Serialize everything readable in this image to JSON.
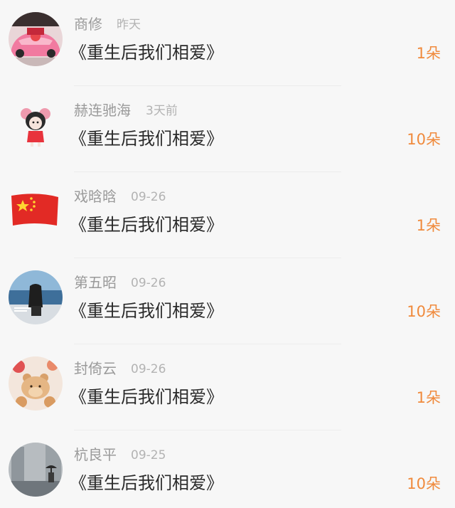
{
  "records": [
    {
      "name": "商修",
      "time": "昨天",
      "book": "《重生后我们相爱》",
      "gift": "1朵",
      "avatar": "pink-car-avatar"
    },
    {
      "name": "赫连驰海",
      "time": "3天前",
      "book": "《重生后我们相爱》",
      "gift": "10朵",
      "avatar": "cartoon-girl-avatar"
    },
    {
      "name": "戏晗晗",
      "time": "09-26",
      "book": "《重生后我们相爱》",
      "gift": "1朵",
      "avatar": "china-flag-avatar"
    },
    {
      "name": "第五昭",
      "time": "09-26",
      "book": "《重生后我们相爱》",
      "gift": "10朵",
      "avatar": "girl-by-sea-avatar"
    },
    {
      "name": "封倚云",
      "time": "09-26",
      "book": "《重生后我们相爱》",
      "gift": "1朵",
      "avatar": "teddy-bear-avatar"
    },
    {
      "name": "杭良平",
      "time": "09-25",
      "book": "《重生后我们相爱》",
      "gift": "10朵",
      "avatar": "rainy-street-avatar"
    }
  ],
  "colors": {
    "background": "#f7f7f7",
    "gift_accent": "#f08a3c",
    "name_gray": "#9a9a9a",
    "time_gray": "#b3b3b3",
    "title_dark": "#2a2a2a"
  }
}
